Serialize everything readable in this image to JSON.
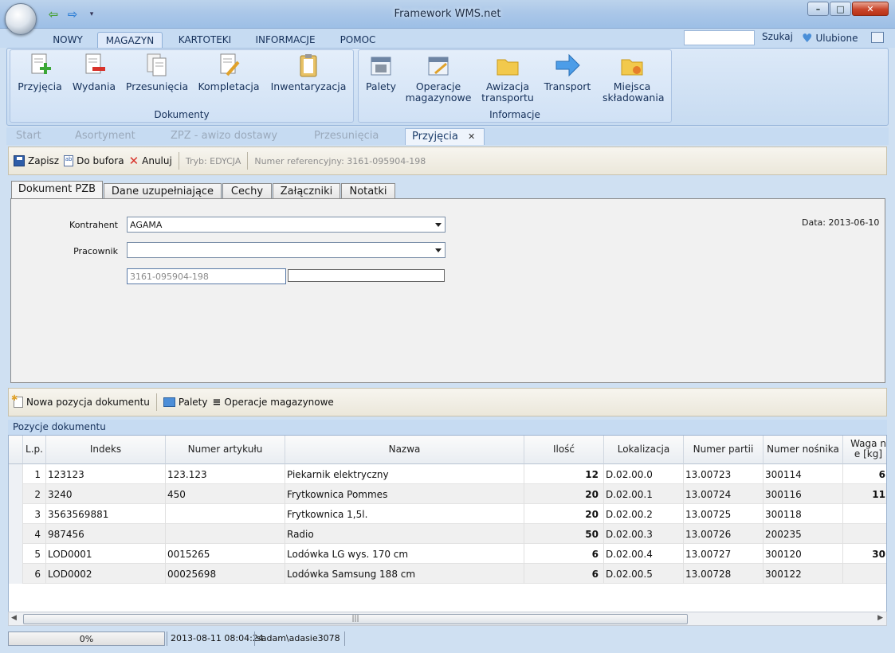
{
  "window": {
    "title": "Framework WMS.net"
  },
  "menu": {
    "tabs": [
      "NOWY",
      "MAGAZYN",
      "KARTOTEKI",
      "INFORMACJE",
      "POMOC"
    ],
    "search_label": "Szukaj",
    "favorites_label": "Ulubione"
  },
  "ribbon": {
    "groups": [
      {
        "title": "Dokumenty",
        "buttons": [
          "Przyjęcia",
          "Wydania",
          "Przesunięcia",
          "Kompletacja",
          "Inwentaryzacja"
        ]
      },
      {
        "title": "Informacje",
        "buttons": [
          "Palety",
          "Operacje magazynowe",
          "Awizacja transportu",
          "Transport",
          "Miejsca składowania"
        ]
      }
    ]
  },
  "doc_tabs": [
    "Start",
    "Asortyment",
    "ZPZ - awizo dostawy",
    "Przesunięcia",
    "Przyjęcia"
  ],
  "toolbar": {
    "save": "Zapisz",
    "buffer": "Do bufora",
    "cancel": "Anuluj",
    "mode": "Tryb: EDYCJA",
    "ref": "Numer referencyjny: 3161-095904-198"
  },
  "inner_tabs": [
    "Dokument PZB",
    "Dane uzupełniające",
    "Cechy",
    "Załączniki",
    "Notatki"
  ],
  "form": {
    "kontrahent_label": "Kontrahent",
    "kontrahent_value": "AGAMA",
    "pracownik_label": "Pracownik",
    "pracownik_value": "",
    "ref_value": "3161-095904-198",
    "date": "Data: 2013-06-10"
  },
  "items_toolbar": {
    "new_item": "Nowa pozycja dokumentu",
    "palety": "Palety",
    "operacje": "Operacje magazynowe"
  },
  "positions": {
    "title": "Pozycje dokumentu",
    "columns": [
      "L.p.",
      "Indeks",
      "Numer artykułu",
      "Nazwa",
      "Ilość",
      "Lokalizacja",
      "Numer partii",
      "Numer nośnika",
      "Waga ne [kg]"
    ],
    "rows": [
      {
        "lp": "1",
        "indeks": "123123",
        "artykul": "123.123",
        "nazwa": "Piekarnik elektryczny",
        "ilosc": "12",
        "lokalizacja": "D.02.00.0",
        "partia": "13.00723",
        "nosnik": "300114",
        "waga": "6"
      },
      {
        "lp": "2",
        "indeks": "3240",
        "artykul": "450",
        "nazwa": "Frytkownica Pommes",
        "ilosc": "20",
        "lokalizacja": "D.02.00.1",
        "partia": "13.00724",
        "nosnik": "300116",
        "waga": "11"
      },
      {
        "lp": "3",
        "indeks": "3563569881",
        "artykul": "",
        "nazwa": "Frytkownica 1,5l.",
        "ilosc": "20",
        "lokalizacja": "D.02.00.2",
        "partia": "13.00725",
        "nosnik": "300118",
        "waga": ""
      },
      {
        "lp": "4",
        "indeks": "987456",
        "artykul": "",
        "nazwa": "Radio",
        "ilosc": "50",
        "lokalizacja": "D.02.00.3",
        "partia": "13.00726",
        "nosnik": "200235",
        "waga": ""
      },
      {
        "lp": "5",
        "indeks": "LOD0001",
        "artykul": "0015265",
        "nazwa": "Lodówka LG wys. 170 cm",
        "ilosc": "6",
        "lokalizacja": "D.02.00.4",
        "partia": "13.00727",
        "nosnik": "300120",
        "waga": "30"
      },
      {
        "lp": "6",
        "indeks": "LOD0002",
        "artykul": "00025698",
        "nazwa": "Lodówka Samsung 188 cm",
        "ilosc": "6",
        "lokalizacja": "D.02.00.5",
        "partia": "13.00728",
        "nosnik": "300122",
        "waga": ""
      }
    ]
  },
  "status": {
    "progress": "0%",
    "datetime": "2013-08-11 08:04:24",
    "user": "sadam\\adasie3078"
  },
  "colors": {
    "accent": "#15305a",
    "ribbon_bg": "#c6dbf2",
    "close_red": "#c9452b"
  }
}
